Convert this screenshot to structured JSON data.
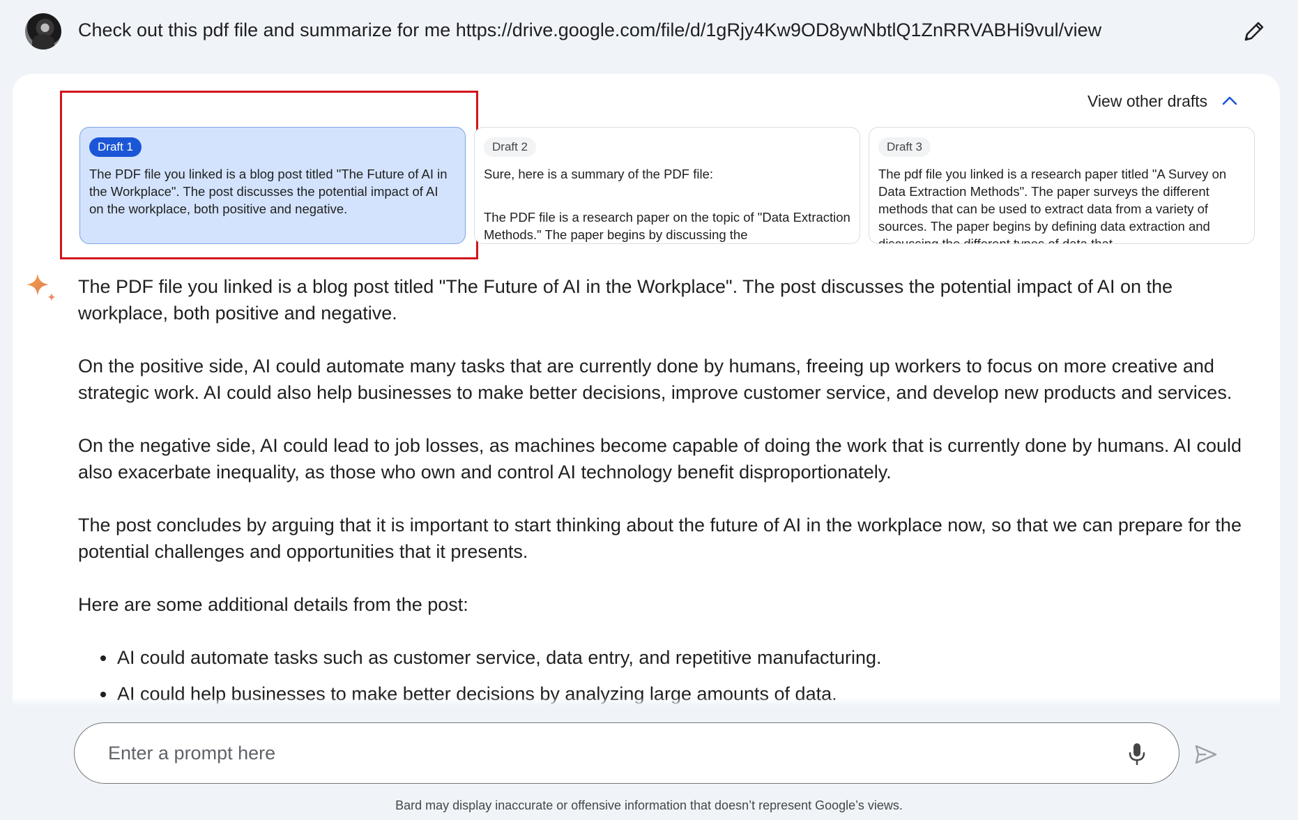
{
  "user_prompt": {
    "text": "Check out this pdf file and summarize for me https://drive.google.com/file/d/1gRjy4Kw9OD8ywNbtlQ1ZnRRVABHi9vul/view"
  },
  "drafts_toggle": {
    "label": "View other drafts"
  },
  "drafts": [
    {
      "label": "Draft 1",
      "selected": true,
      "paragraphs": [
        "The PDF file you linked is a blog post titled \"The Future of AI in the Workplace\". The post discusses the potential impact of AI on the workplace, both positive and negative."
      ]
    },
    {
      "label": "Draft 2",
      "selected": false,
      "paragraphs": [
        "Sure, here is a summary of the PDF file:",
        "The PDF file is a research paper on the topic of \"Data Extraction Methods.\" The paper begins by discussing the"
      ]
    },
    {
      "label": "Draft 3",
      "selected": false,
      "paragraphs": [
        "The pdf file you linked is a research paper titled \"A Survey on Data Extraction Methods\". The paper surveys the different methods that can be used to extract data from a variety of sources. The paper begins by defining data extraction and discussing the different types of data that"
      ]
    }
  ],
  "response": {
    "paragraphs": [
      "The PDF file you linked is a blog post titled \"The Future of AI in the Workplace\". The post discusses the potential impact of AI on the workplace, both positive and negative.",
      "On the positive side, AI could automate many tasks that are currently done by humans, freeing up workers to focus on more creative and strategic work. AI could also help businesses to make better decisions, improve customer service, and develop new products and services.",
      "On the negative side, AI could lead to job losses, as machines become capable of doing the work that is currently done by humans. AI could also exacerbate inequality, as those who own and control AI technology benefit disproportionately.",
      "The post concludes by arguing that it is important to start thinking about the future of AI in the workplace now, so that we can prepare for the potential challenges and opportunities that it presents.",
      "Here are some additional details from the post:"
    ],
    "bullets": [
      "AI could automate tasks such as customer service, data entry, and repetitive manufacturing.",
      "AI could help businesses to make better decisions by analyzing large amounts of data."
    ]
  },
  "input": {
    "placeholder": "Enter a prompt here",
    "value": ""
  },
  "disclaimer": "Bard may display inaccurate or offensive information that doesn’t represent Google’s views.",
  "icons": {
    "edit": "pencil-icon",
    "chevron": "chevron-up-icon",
    "sparkle": "bard-sparkle-icon",
    "mic": "microphone-icon",
    "send": "send-icon"
  },
  "colors": {
    "highlight_border": "#d3121b",
    "selected_draft_bg": "#d3e3fd",
    "selected_chip_bg": "#1a56d6",
    "accent_blue": "#1a56d6",
    "page_bg": "#f0f4f9"
  }
}
